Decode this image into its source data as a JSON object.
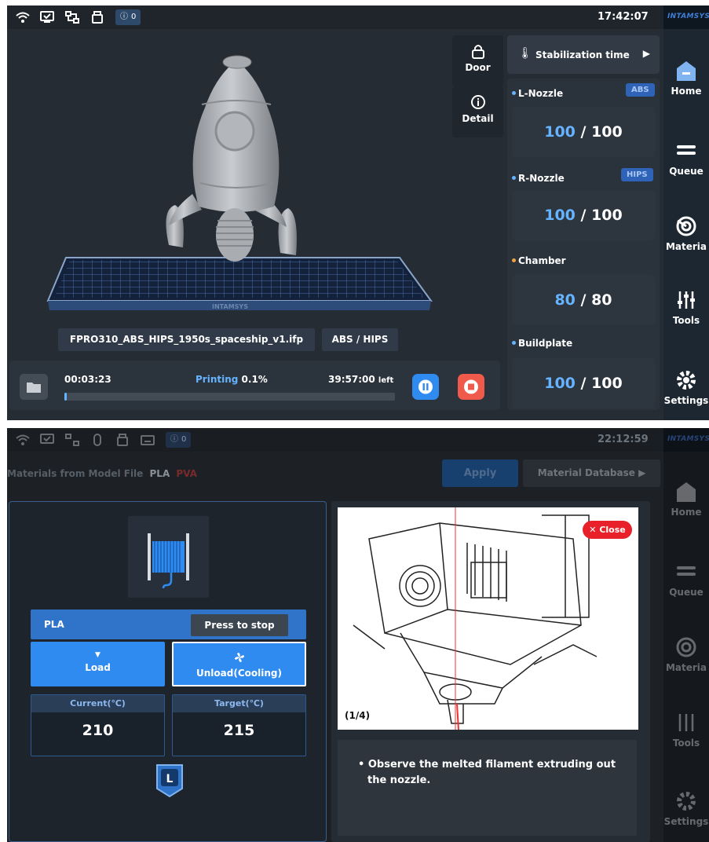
{
  "screen1": {
    "statusbar": {
      "alerts": "0",
      "time": "17:42:07"
    },
    "brand": "INTAMSYS",
    "nav": [
      {
        "label": "Home",
        "icon": "home-icon"
      },
      {
        "label": "Queue",
        "icon": "queue-icon"
      },
      {
        "label": "Materia",
        "icon": "material-icon"
      },
      {
        "label": "Tools",
        "icon": "tools-icon"
      },
      {
        "label": "Settings",
        "icon": "settings-icon"
      }
    ],
    "door_label": "Door",
    "detail_label": "Detail",
    "stabilization": "Stabilization time",
    "l_nozzle": {
      "label": "L-Nozzle",
      "tag": "ABS",
      "current": "100",
      "target": "100"
    },
    "r_nozzle": {
      "label": "R-Nozzle",
      "tag": "HIPS",
      "current": "100",
      "target": "100"
    },
    "chamber": {
      "label": "Chamber",
      "current": "80",
      "target": "80"
    },
    "buildplate": {
      "label": "Buildplate",
      "current": "100",
      "target": "100"
    },
    "plate_brand": "INTAMSYS",
    "file_name": "FPRO310_ABS_HIPS_1950s_spaceship_v1.ifp",
    "materials": "ABS / HIPS",
    "elapsed": "00:03:23",
    "status_word": "Printing",
    "progress_text": "0.1%",
    "progress": 0.001,
    "remaining": "39:57:00",
    "remaining_suffix": "left",
    "colors": {
      "accent": "#66b3ff",
      "pause": "#2f8bf0",
      "stop": "#f05a4a"
    }
  },
  "screen2": {
    "statusbar": {
      "alerts": "0",
      "time": "22:12:59"
    },
    "brand": "INTAMSYS",
    "nav": [
      {
        "label": "Home",
        "icon": "home-icon"
      },
      {
        "label": "Queue",
        "icon": "queue-icon"
      },
      {
        "label": "Materia",
        "icon": "material-icon"
      },
      {
        "label": "Tools",
        "icon": "tools-icon"
      },
      {
        "label": "Settings",
        "icon": "settings-icon"
      }
    ],
    "materials_from_file": "Materials from Model File",
    "mat_pla": "PLA",
    "mat_pva": "PVA",
    "apply": "Apply",
    "database": "Material Database",
    "material_name": "PLA",
    "tooltip": "Press to stop",
    "load": "Load",
    "unload": "Unload(Cooling)",
    "current_label": "Current(℃)",
    "target_label": "Target(℃)",
    "current_val": "210",
    "target_val": "215",
    "extruder_badge": "L",
    "close": "Close",
    "step": "(1/4)",
    "instruction": "Observe the melted filament extruding out the nozzle."
  }
}
